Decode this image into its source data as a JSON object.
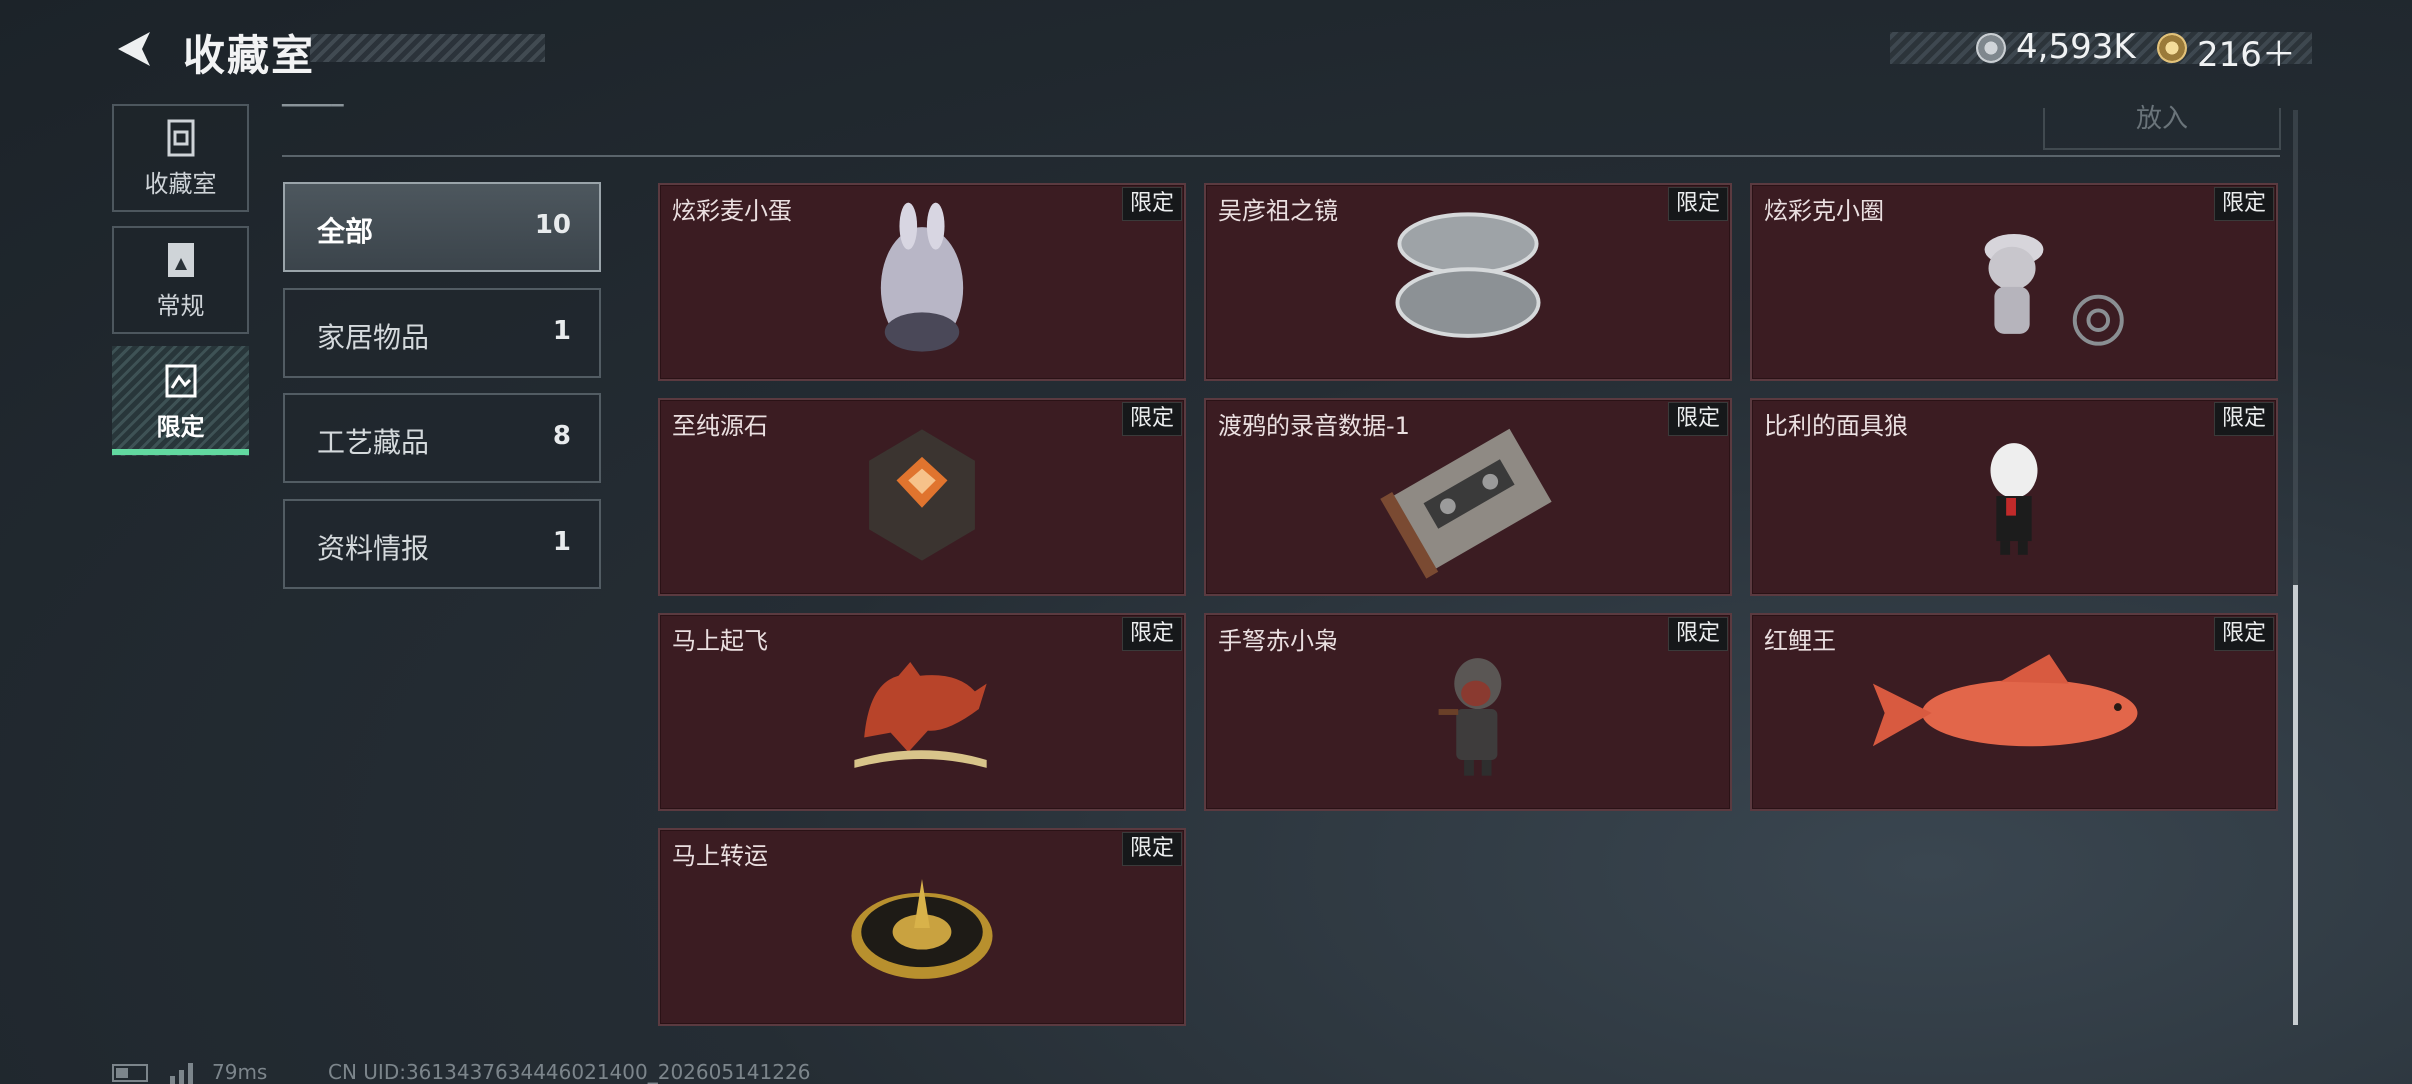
{
  "header": {
    "title": "收藏室",
    "currency_silver": "4,593K",
    "currency_gold": "216＋"
  },
  "rail": [
    {
      "label": "收藏室"
    },
    {
      "label": "常规"
    },
    {
      "label": "限定"
    }
  ],
  "top": {
    "put_in_label": "放入"
  },
  "categories": [
    {
      "name": "全部",
      "count": "10"
    },
    {
      "name": "家居物品",
      "count": "1"
    },
    {
      "name": "工艺藏品",
      "count": "8"
    },
    {
      "name": "资料情报",
      "count": "1"
    }
  ],
  "items": [
    {
      "name": "炫彩麦小蛋",
      "tag": "限定",
      "icon": "rabbit-egg-icon"
    },
    {
      "name": "吴彦祖之镜",
      "tag": "限定",
      "icon": "compact-mirror-icon"
    },
    {
      "name": "炫彩克小圈",
      "tag": "限定",
      "icon": "figure-icon"
    },
    {
      "name": "至纯源石",
      "tag": "限定",
      "icon": "gem-stone-icon"
    },
    {
      "name": "渡鸦的录音数据-1",
      "tag": "限定",
      "icon": "cassette-tape-icon"
    },
    {
      "name": "比利的面具狼",
      "tag": "限定",
      "icon": "puppet-figure-icon"
    },
    {
      "name": "马上起飞",
      "tag": "限定",
      "icon": "horse-statue-icon"
    },
    {
      "name": "手弩赤小枭",
      "tag": "限定",
      "icon": "hooded-figure-icon"
    },
    {
      "name": "红鲤王",
      "tag": "限定",
      "icon": "red-carp-icon"
    },
    {
      "name": "马上转运",
      "tag": "限定",
      "icon": "golden-compass-icon"
    }
  ],
  "footer": {
    "ping": "79ms",
    "uid": "CN UID:3613437634446021400_202605141226"
  },
  "colors": {
    "accent": "#62d9a0",
    "card_bg": "#3b1c22"
  }
}
